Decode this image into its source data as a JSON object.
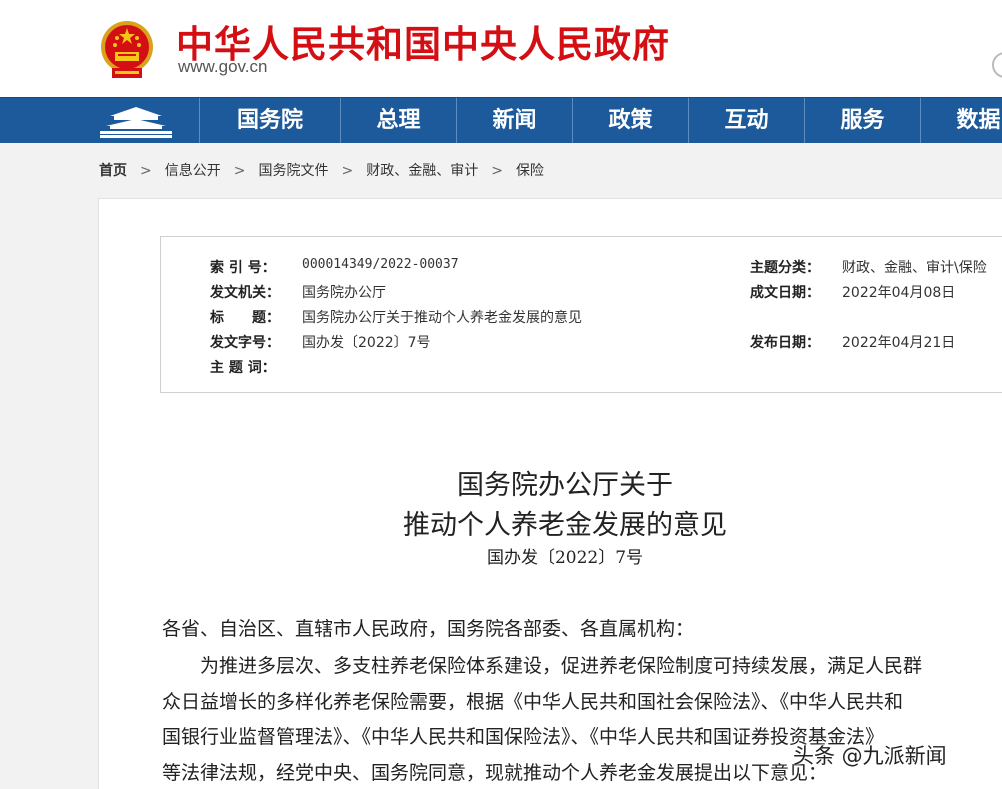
{
  "header": {
    "site_name": "中华人民共和国中央人民政府",
    "site_domain": "www.gov.cn"
  },
  "nav": {
    "items": [
      "国务院",
      "总理",
      "新闻",
      "政策",
      "互动",
      "服务",
      "数据"
    ]
  },
  "breadcrumb": {
    "items": [
      "首页",
      "信息公开",
      "国务院文件",
      "财政、金融、审计",
      "保险"
    ],
    "separator": ">"
  },
  "info": {
    "index_label": "索 引 号：",
    "index_value": "000014349/2022-00037",
    "topic_label": "主题分类：",
    "topic_value": "财政、金融、审计\\保险",
    "issuer_label": "发文机关：",
    "issuer_value": "国务院办公厅",
    "written_date_label": "成文日期：",
    "written_date_value": "2022年04月08日",
    "title_label": "标　　题：",
    "title_value": "国务院办公厅关于推动个人养老金发展的意见",
    "doc_no_label": "发文字号：",
    "doc_no_value": "国办发〔2022〕7号",
    "publish_date_label": "发布日期：",
    "publish_date_value": "2022年04月21日",
    "keywords_label": "主 题 词：",
    "keywords_value": ""
  },
  "document": {
    "title_line1": "国务院办公厅关于",
    "title_line2": "推动个人养老金发展的意见",
    "number": "国办发〔2022〕7号",
    "lines": [
      "各省、自治区、直辖市人民政府，国务院各部委、各直属机构：",
      "　　为推进多层次、多支柱养老保险体系建设，促进养老保险制度可持续发展，满足人民群",
      "众日益增长的多样化养老保险需要，根据《中华人民共和国社会保险法》、《中华人民共和",
      "国银行业监督管理法》、《中华人民共和国保险法》、《中华人民共和国证券投资基金法》",
      "等法律法规，经党中央、国务院同意，现就推动个人养老金发展提出以下意见："
    ]
  },
  "watermark": "头条 @九派新闻",
  "colors": {
    "brand_red": "#d40f14",
    "nav_blue": "#1c5a9b"
  }
}
